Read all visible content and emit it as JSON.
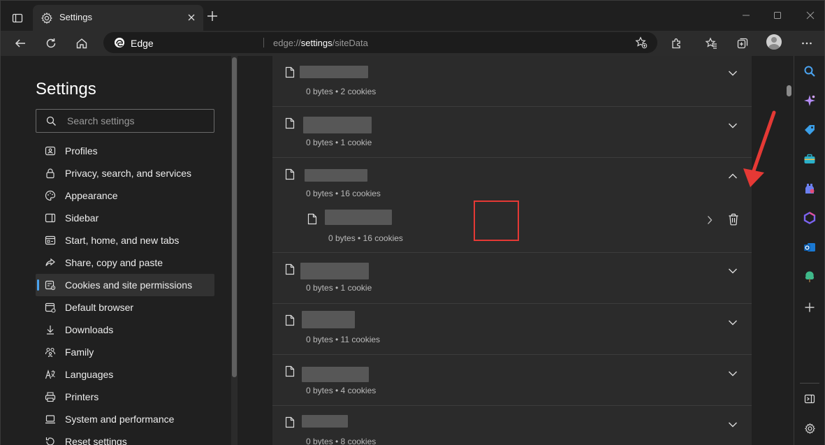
{
  "window": {
    "tab_title": "Settings"
  },
  "address_bar": {
    "brand": "Edge",
    "url_prefix": "edge://",
    "url_host": "settings",
    "url_path": "/siteData"
  },
  "nav": {
    "title": "Settings",
    "search_placeholder": "Search settings",
    "items": [
      {
        "label": "Profiles",
        "icon": "profile-card-icon"
      },
      {
        "label": "Privacy, search, and services",
        "icon": "lock-icon"
      },
      {
        "label": "Appearance",
        "icon": "palette-icon"
      },
      {
        "label": "Sidebar",
        "icon": "sidebar-icon"
      },
      {
        "label": "Start, home, and new tabs",
        "icon": "home-tabs-icon"
      },
      {
        "label": "Share, copy and paste",
        "icon": "share-icon"
      },
      {
        "label": "Cookies and site permissions",
        "icon": "cookie-permissions-icon",
        "active": true
      },
      {
        "label": "Default browser",
        "icon": "browser-icon"
      },
      {
        "label": "Downloads",
        "icon": "download-icon"
      },
      {
        "label": "Family",
        "icon": "family-icon"
      },
      {
        "label": "Languages",
        "icon": "languages-icon"
      },
      {
        "label": "Printers",
        "icon": "printer-icon"
      },
      {
        "label": "System and performance",
        "icon": "laptop-icon"
      },
      {
        "label": "Reset settings",
        "icon": "reset-icon"
      }
    ]
  },
  "site_rows": [
    {
      "meta": "0 bytes • 2 cookies",
      "expanded": false
    },
    {
      "meta": "0 bytes • 1 cookie",
      "expanded": false
    },
    {
      "meta": "0 bytes • 16 cookies",
      "expanded": true,
      "child": {
        "meta": "0 bytes • 16 cookies"
      }
    },
    {
      "meta": "0 bytes • 1 cookie",
      "expanded": false
    },
    {
      "meta": "0 bytes • 11 cookies",
      "expanded": false
    },
    {
      "meta": "0 bytes • 4 cookies",
      "expanded": false
    },
    {
      "meta": "0 bytes • 8 cookies",
      "expanded": false
    }
  ],
  "colors": {
    "accent": "#4aa3f0",
    "annotation": "#e53935"
  },
  "right_sidebar_icons": [
    "search-icon",
    "copilot-icon",
    "shopping-tag-icon",
    "tools-icon",
    "games-icon",
    "microsoft365-icon",
    "outlook-icon",
    "tree-icon",
    "add-icon",
    "sidebar-toggle-icon",
    "settings-gear-icon"
  ]
}
